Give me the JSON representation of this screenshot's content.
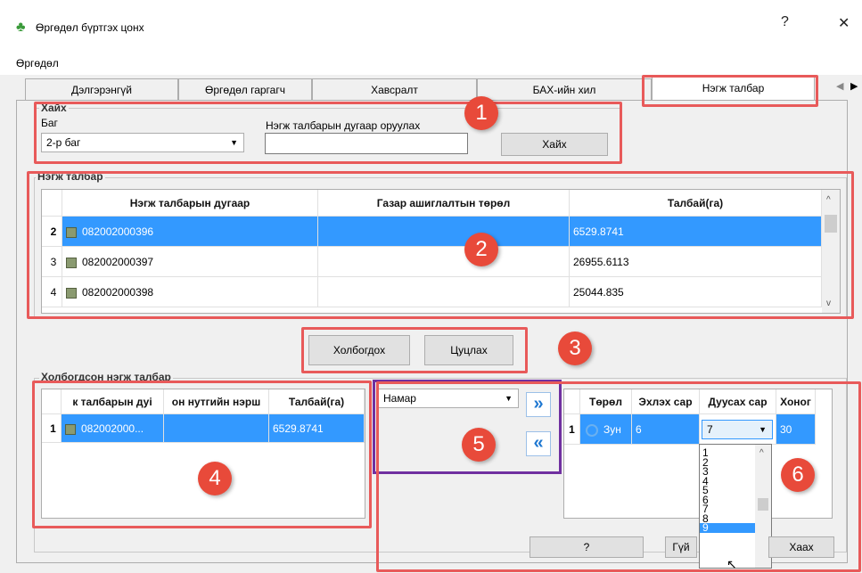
{
  "window": {
    "title": "Өргөдөл бүртгэх цонх",
    "help_btn": "?",
    "close_btn": "✕"
  },
  "menu": {
    "item": "Өргөдөл"
  },
  "tabs": [
    "Дэлгэрэнгүй",
    "Өргөдөл гаргагч",
    "Хавсралт",
    "БАХ-ийн хил",
    "Нэгж талбар"
  ],
  "tab_active": "Нэгж талбар",
  "tab_scroll": {
    "left": "◀",
    "right": "▶"
  },
  "search": {
    "group_title": "Хайх",
    "bag_label": "Баг",
    "bag_value": "2-р баг",
    "parcel_label": "Нэгж талбарын дугаар оруулах",
    "parcel_value": "",
    "search_btn": "Хайх"
  },
  "parcel_group": {
    "title": "Нэгж талбар",
    "columns": [
      "Нэгж талбарын дугаар",
      "Газар ашиглалтын төрөл",
      "Талбай(га)"
    ],
    "rows": [
      {
        "num": "2",
        "id": "082002000396",
        "type": "",
        "area": "6529.8741"
      },
      {
        "num": "3",
        "id": "082002000397",
        "type": "",
        "area": "26955.6113"
      },
      {
        "num": "4",
        "id": "082002000398",
        "type": "",
        "area": "25044.835"
      }
    ]
  },
  "link_buttons": {
    "connect": "Холбогдох",
    "cancel": "Цуцлах"
  },
  "linked_group": {
    "title": "Холбогдсон нэгж талбар",
    "columns": [
      "к талбарын дуі",
      "он нутгийн нэрш",
      "Талбай(га)"
    ],
    "rows": [
      {
        "num": "1",
        "id": "082002000...",
        "region": "",
        "area": "6529.8741"
      }
    ]
  },
  "season": {
    "value": "Намар",
    "add_btn": "»",
    "remove_btn": "«"
  },
  "period_grid": {
    "columns": [
      "Төрөл",
      "Эхлэх сар",
      "Дуусах сар",
      "Хоног"
    ],
    "row": {
      "num": "1",
      "type": "Зун",
      "start": "6",
      "end": "7",
      "days": "30"
    },
    "dropdown_options": [
      "1",
      "2",
      "3",
      "4",
      "5",
      "6",
      "7",
      "8",
      "9"
    ],
    "dropdown_selected": "9"
  },
  "bottom_buttons": {
    "help": "?",
    "apply": "Гүй",
    "close": "Хаах"
  },
  "annotations": [
    "1",
    "2",
    "3",
    "4",
    "5",
    "6"
  ]
}
